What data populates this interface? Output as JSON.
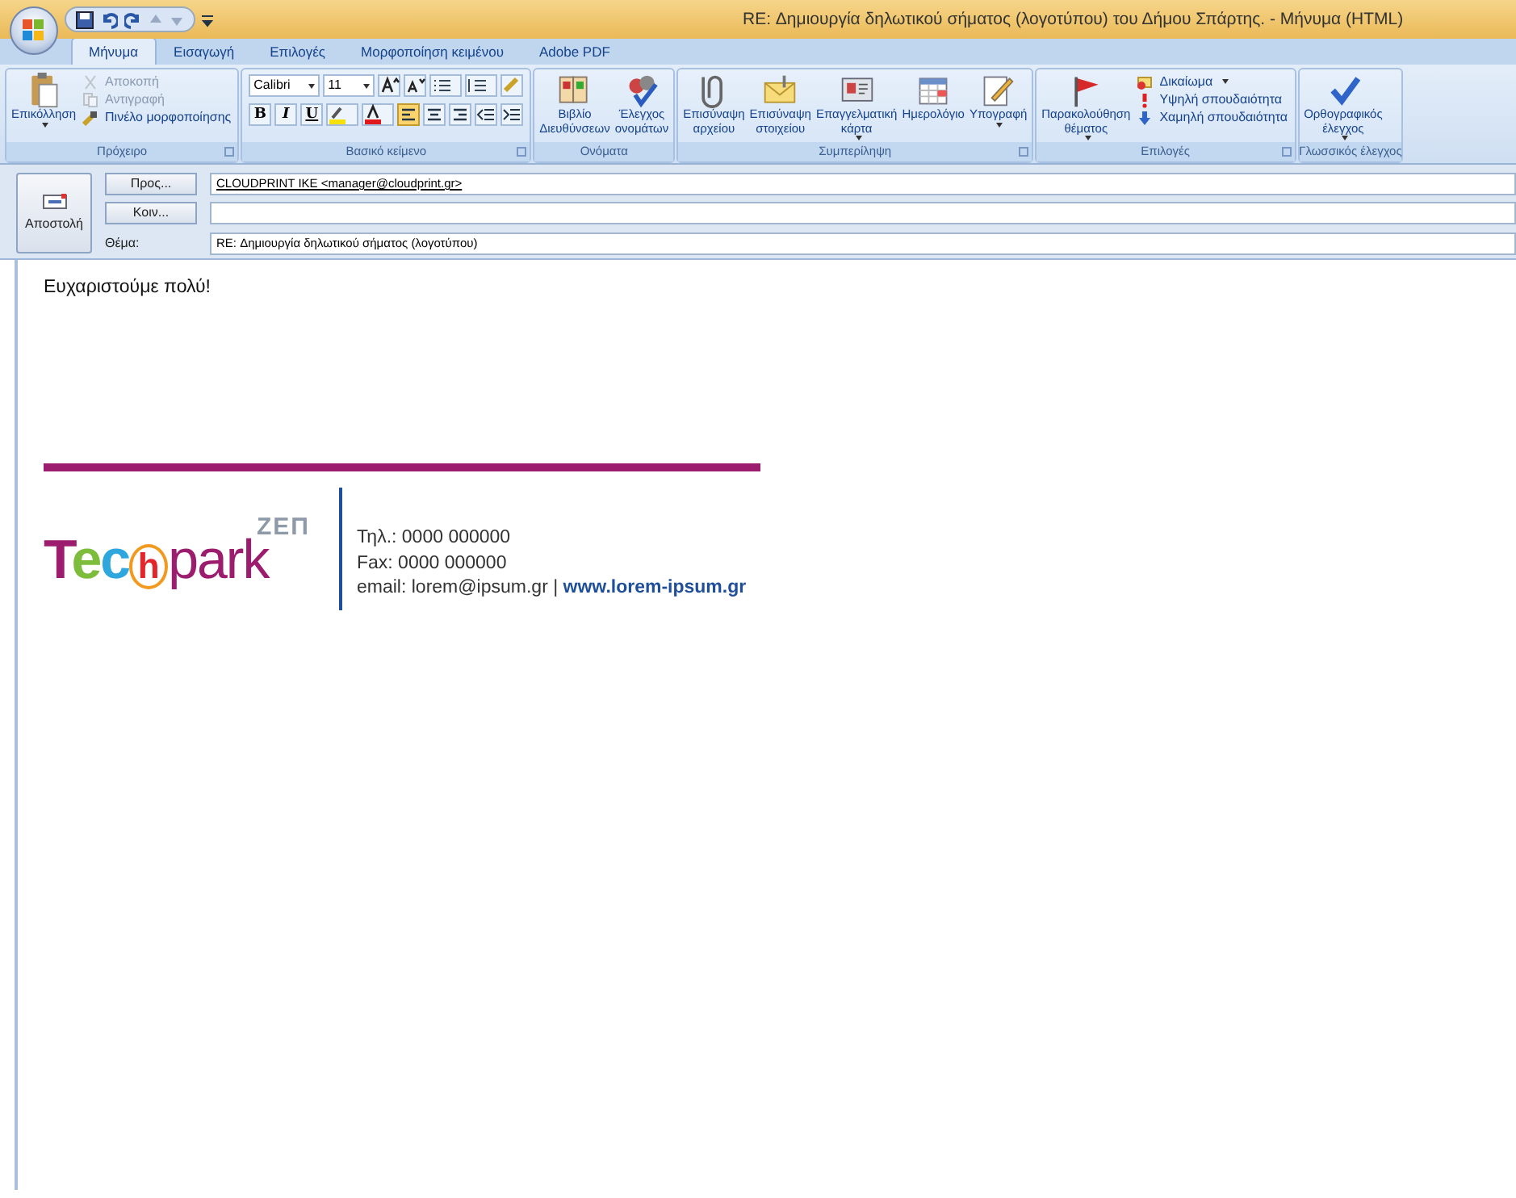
{
  "window": {
    "title": "RE: Δημιουργία δηλωτικού σήματος (λογοτύπου) του Δήμου Σπάρτης. - Μήνυμα (HTML)"
  },
  "tabs": [
    {
      "label": "Μήνυμα",
      "selected": true
    },
    {
      "label": "Εισαγωγή",
      "selected": false
    },
    {
      "label": "Επιλογές",
      "selected": false
    },
    {
      "label": "Μορφοποίηση κειμένου",
      "selected": false
    },
    {
      "label": "Adobe PDF",
      "selected": false
    }
  ],
  "ribbon": [
    {
      "kind": "clipboard",
      "label": "Πρόχειρο",
      "launcher": true,
      "large": [
        {
          "label": "Επικόλληση",
          "dropdown": true
        }
      ],
      "small": [
        {
          "label": "Αποκοπή",
          "disabled": true
        },
        {
          "label": "Αντιγραφή",
          "disabled": true
        },
        {
          "label": "Πινέλο μορφοποίησης",
          "disabled": false
        }
      ]
    },
    {
      "kind": "font",
      "label": "Βασικό κείμενο",
      "launcher": true,
      "font_name": "Calibri",
      "font_size": "11",
      "format_buttons": [
        "B",
        "I",
        "U"
      ],
      "align": [
        {
          "selected": true
        },
        {
          "selected": false
        },
        {
          "selected": false
        }
      ]
    },
    {
      "kind": "buttons",
      "label": "Ονόματα",
      "launcher": false,
      "large": [
        {
          "label": "Βιβλίο\nΔιευθύνσεων",
          "dropdown": false
        },
        {
          "label": "Έλεγχος\nονομάτων",
          "dropdown": false
        }
      ]
    },
    {
      "kind": "buttons",
      "label": "Συμπερίληψη",
      "launcher": true,
      "large": [
        {
          "label": "Επισύναψη\nαρχείου",
          "dropdown": false
        },
        {
          "label": "Επισύναψη\nστοιχείου",
          "dropdown": false
        },
        {
          "label": "Επαγγελματική\nκάρτα",
          "dropdown": true
        },
        {
          "label": "Ημερολόγιο",
          "dropdown": false
        },
        {
          "label": "Υπογραφή",
          "dropdown": true
        }
      ]
    },
    {
      "kind": "clipboard",
      "label": "Επιλογές",
      "launcher": true,
      "large": [
        {
          "label": "Παρακολούθηση\nθέματος",
          "dropdown": true
        }
      ],
      "small": [
        {
          "label": "Δικαίωμα",
          "disabled": false,
          "dropdown": true
        },
        {
          "label": "Υψηλή σπουδαιότητα",
          "disabled": false
        },
        {
          "label": "Χαμηλή σπουδαιότητα",
          "disabled": false
        }
      ]
    },
    {
      "kind": "buttons",
      "label": "Γλωσσικός έλεγχος",
      "launcher": false,
      "large": [
        {
          "label": "Ορθογραφικός\nέλεγχος",
          "dropdown": true
        }
      ]
    }
  ],
  "header": {
    "send": "Αποστολή",
    "to_button": "Προς...",
    "to_value": "CLOUDPRINT IKE <manager@cloudprint.gr>",
    "cc_button": "Κοιν...",
    "subject_label": "Θέμα:",
    "subject_value": "RE: Δημιουργία δηλωτικού σήματος (λογοτύπου)"
  },
  "body": {
    "text": "Ευχαριστούμε πολύ!",
    "signature": {
      "logo": {
        "badge": "ΖΕΠ",
        "letters": [
          {
            "text": "T",
            "color": "#9c1c6e"
          },
          {
            "text": "e",
            "color": "#7dbd3b"
          },
          {
            "text": "c",
            "color": "#2ea7de"
          },
          {
            "text": "h",
            "color": "#e3262b"
          },
          {
            "text": "park",
            "color": "#9c1c6e"
          }
        ]
      },
      "phone": "Τηλ.: 0000 000000",
      "fax": "Fax: 0000 000000",
      "email": "email: lorem@ipsum.gr | ",
      "website": "www.lorem-ipsum.gr"
    }
  }
}
